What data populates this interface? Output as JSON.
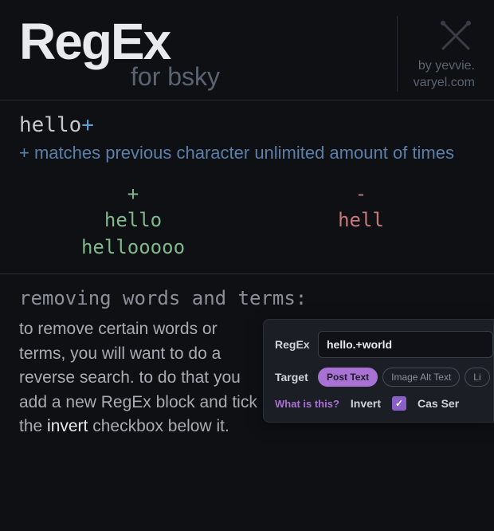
{
  "header": {
    "title": "RegEx",
    "subtitle": "for bsky",
    "byline1": "by yevvie.",
    "byline2": "varyel.com"
  },
  "demo": {
    "pattern_base": "hello",
    "pattern_suffix": "+",
    "explain_prefix": "+",
    "explain_text": " matches previous character unlimited amount of times",
    "positive_header": "+",
    "positive": [
      "hello",
      "hellooooo"
    ],
    "negative_header": "-",
    "negative": [
      "hell"
    ]
  },
  "section": {
    "title": "removing words and terms:",
    "body_1": "to remove certain words or terms, you will want to do a reverse search. to do that you add a new RegEx block and tick the ",
    "body_em": "invert",
    "body_2": " checkbox below it."
  },
  "panel": {
    "regex_label": "RegEx",
    "regex_value": "hello.+world",
    "target_label": "Target",
    "chips": [
      "Post Text",
      "Image Alt Text",
      "Li"
    ],
    "what": "What is this?",
    "invert_label": "Invert",
    "case_label": "Cas\nSer"
  }
}
